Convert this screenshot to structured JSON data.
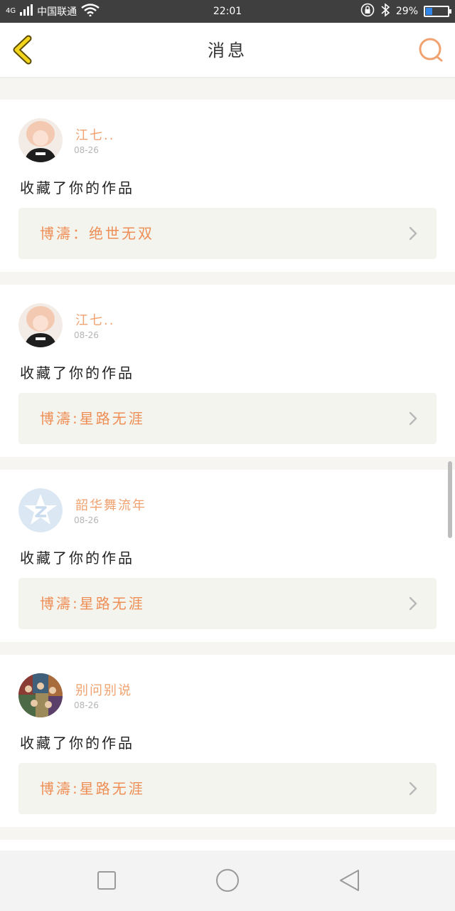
{
  "status_bar": {
    "network_type": "4G",
    "carrier": "中国联通",
    "time": "22:01",
    "battery_percent": "29%",
    "battery_level": 0.29,
    "icons": [
      "signal-icon",
      "wifi-icon",
      "rotation-lock-icon",
      "bluetooth-icon",
      "battery-icon"
    ]
  },
  "header": {
    "title": "消息",
    "back_icon": "chevron-left-icon",
    "search_icon": "search-icon",
    "accent_color": "#f0a270"
  },
  "messages": [
    {
      "user": "江七..",
      "date": "08-26",
      "text": "收藏了你的作品",
      "work": "博濤：绝世无双"
    },
    {
      "user": "江七..",
      "date": "08-26",
      "text": "收藏了你的作品",
      "work": "博濤:星路无涯"
    },
    {
      "user": "韶华舞流年",
      "date": "08-26",
      "text": "收藏了你的作品",
      "work": "博濤:星路无涯"
    },
    {
      "user": "别问别说",
      "date": "08-26",
      "text": "收藏了你的作品",
      "work": "博濤:星路无涯"
    }
  ],
  "nav_bar": {
    "icons": [
      "recent-apps-icon",
      "home-icon",
      "back-icon"
    ]
  }
}
